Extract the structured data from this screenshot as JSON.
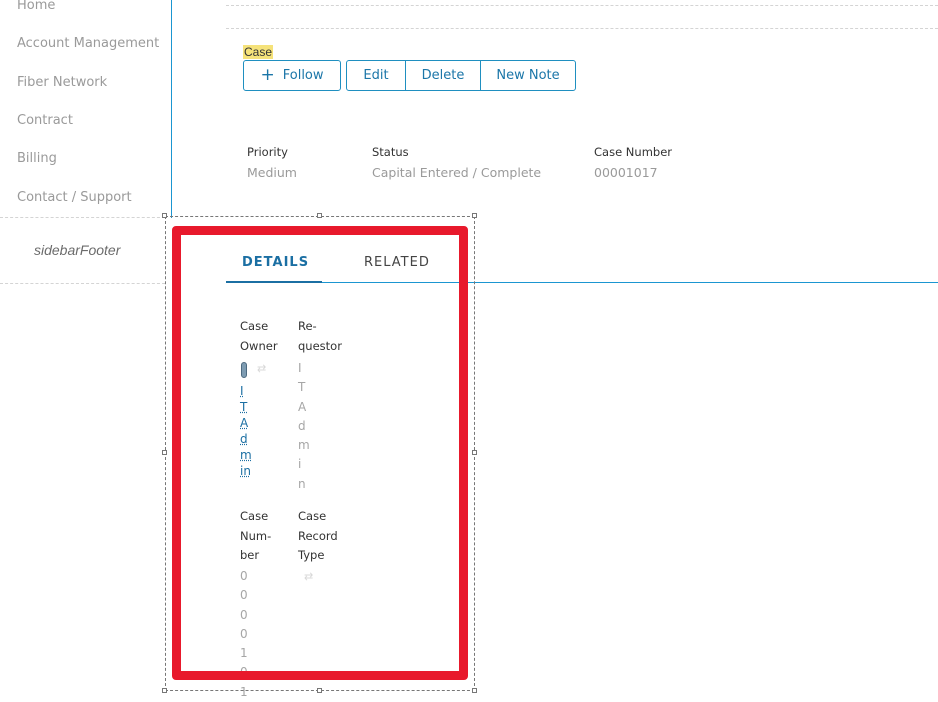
{
  "sidebar": {
    "items": [
      {
        "label": "Home"
      },
      {
        "label": "Account Management"
      },
      {
        "label": "Fiber Network"
      },
      {
        "label": "Contract"
      },
      {
        "label": "Billing"
      },
      {
        "label": "Contact / Support"
      }
    ],
    "footer": "sidebarFooter"
  },
  "record": {
    "object_label": "Case",
    "actions": {
      "follow": "Follow",
      "edit": "Edit",
      "delete": "Delete",
      "new_note": "New Note"
    },
    "highlights": [
      {
        "label": "Priority",
        "value": "Medium"
      },
      {
        "label": "Status",
        "value": "Capital Entered / Complete"
      },
      {
        "label": "Case Number",
        "value": "00001017"
      }
    ]
  },
  "tabs": {
    "details": "DETAILS",
    "related": "RELATED"
  },
  "detail_fields": {
    "case_owner_label": [
      "Case",
      "Owner"
    ],
    "requestor_label": [
      "Re-",
      "questor"
    ],
    "case_owner_value": [
      "I",
      "T",
      "A",
      "d",
      "m",
      "in"
    ],
    "requestor_value": [
      "I",
      "T",
      "A",
      "d",
      "m",
      "i",
      "n"
    ],
    "case_number_label": [
      "Case",
      "Num-",
      "ber"
    ],
    "case_record_type_label": [
      "Case",
      "Record",
      "Type"
    ],
    "case_number_value": [
      "0",
      "0",
      "0",
      "0",
      "1",
      "0",
      "1"
    ]
  },
  "colors": {
    "accent": "#1b6fa3",
    "divider": "#1b96d1",
    "highlight_annotation": "#e8192c",
    "case_label_highlight": "#f5e27a"
  }
}
